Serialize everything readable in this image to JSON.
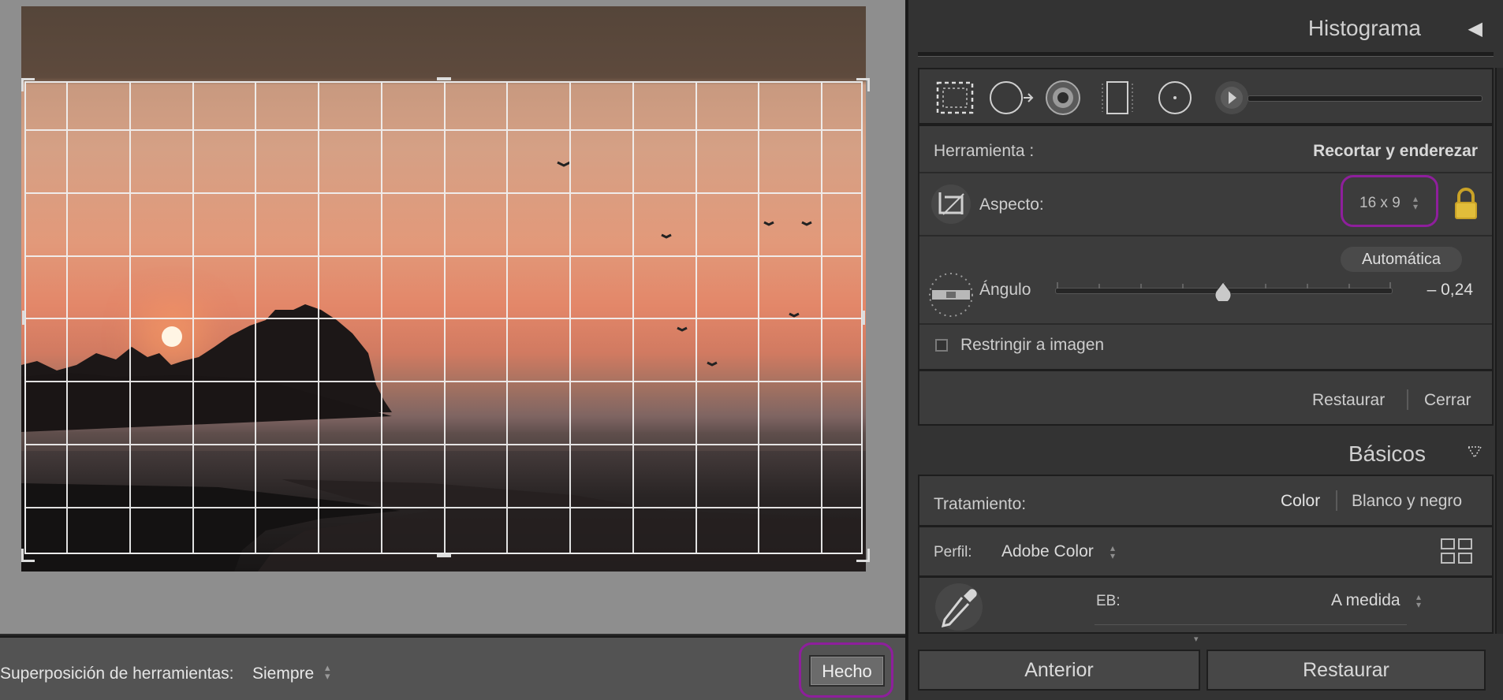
{
  "toolbar": {
    "overlay_label": "Superposición de herramientas:",
    "overlay_value": "Siempre",
    "done_label": "Hecho"
  },
  "panel": {
    "histogram_title": "Histograma",
    "tool_label": "Herramienta :",
    "tool_value": "Recortar y enderezar",
    "aspect_label": "Aspecto:",
    "aspect_value": "16 x 9",
    "auto_label": "Automática",
    "angle_label": "Ángulo",
    "angle_value": "– 0,24",
    "angle_fraction": 0.5,
    "constrain_label": "Restringir a imagen",
    "reset_label": "Restaurar",
    "close_label": "Cerrar",
    "basics_title": "Básicos",
    "treatment_label": "Tratamiento:",
    "treatment_color": "Color",
    "treatment_bw": "Blanco y negro",
    "profile_label": "Perfil:",
    "profile_value": "Adobe Color",
    "wb_label": "EB:",
    "wb_value": "A medida",
    "prev_button": "Anterior",
    "reset_button": "Restaurar"
  },
  "colors": {
    "highlight": "#8e1f9c",
    "lock": "#c9a227"
  }
}
